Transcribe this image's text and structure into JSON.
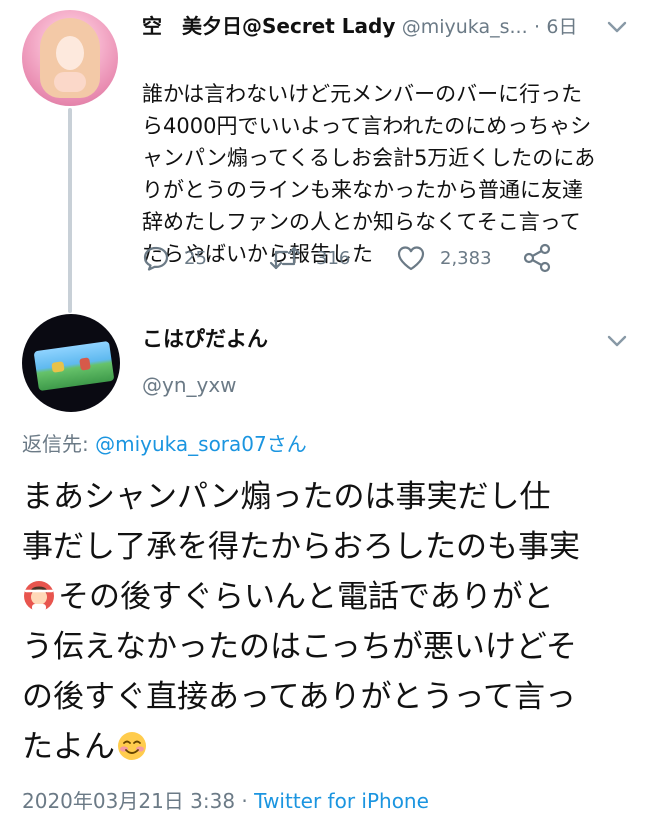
{
  "tweet1": {
    "display_name": "空　美夕日@Secret Lady",
    "handle": "@miyuka_s...",
    "separator": "·",
    "time": "6日",
    "body_lines": [
      "誰かは言わないけど元メンバーのバーに行った",
      "ら4000円でいいよって言われたのにめっちゃシ",
      "ャンパン煽ってくるしお会計5万近くしたのにあ",
      "りがとうのラインも来なかったから普通に友達",
      "辞めたしファンの人とか知らなくてそこ言って",
      "たらやばいから報告した"
    ],
    "reply_count": "25",
    "retweet_count": "316",
    "like_count": "2,383"
  },
  "tweet2": {
    "display_name": "こはぴだよん",
    "handle": "@yn_yxw",
    "reply_prefix": "返信先: ",
    "reply_mention": "@miyuka_sora07さん",
    "body_lines": [
      "まあシャンパン煽ったのは事実だし仕",
      "事だし了承を得たからおろしたのも事実",
      "その後すぐらいんと電話でありがと",
      "う伝えなかったのはこっちが悪いけどそ",
      "の後すぐ直接あってありがとうって言っ",
      "たよん"
    ],
    "timestamp": "2020年03月21日 3:38",
    "meta_separator": " · ",
    "source": "Twitter for iPhone"
  },
  "icons": {
    "reply": "reply-icon",
    "retweet": "retweet-icon",
    "like": "heart-icon",
    "share": "share-icon",
    "more": "chevron-down-icon"
  },
  "colors": {
    "accent": "#1b95e0",
    "secondary_text": "#6b7a86",
    "thread_line": "#c8d0d7"
  }
}
